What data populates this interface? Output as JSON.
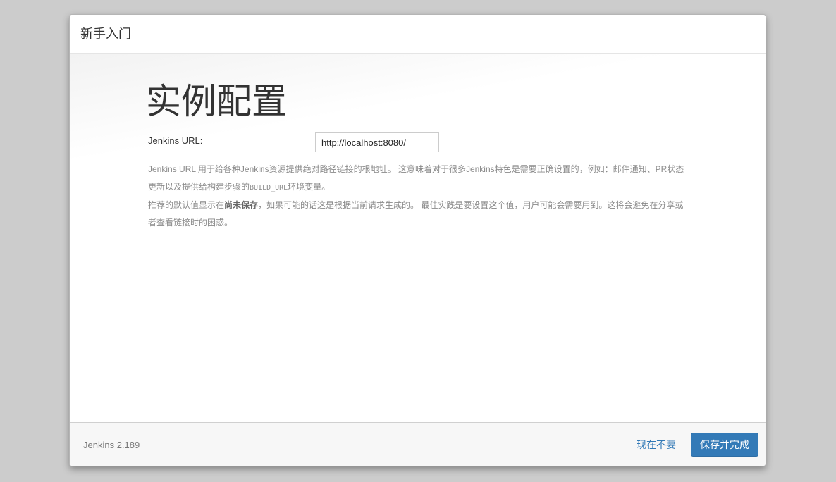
{
  "dialog": {
    "header_title": "新手入门"
  },
  "main": {
    "page_title": "实例配置",
    "url_label": "Jenkins URL:",
    "url_value": "http://localhost:8080/",
    "help": {
      "p1_a": "Jenkins URL 用于给各种Jenkins资源提供绝对路径链接的根地址。 这意味着对于很多Jenkins特色是需要正确设置的，例如：邮件通知、PR状态更新以及提供给构建步骤的",
      "p1_code": "BUILD_URL",
      "p1_b": "环境变量。",
      "p2_a": "推荐的默认值显示在",
      "p2_bold": "尚未保存",
      "p2_b": "，如果可能的话这是根据当前请求生成的。 最佳实践是要设置这个值，用户可能会需要用到。这将会避免在分享或者查看链接时的困惑。"
    }
  },
  "footer": {
    "version": "Jenkins 2.189",
    "skip_label": "现在不要",
    "save_label": "保存并完成"
  },
  "colors": {
    "primary": "#337ab7",
    "overlay": "#cccccc"
  }
}
